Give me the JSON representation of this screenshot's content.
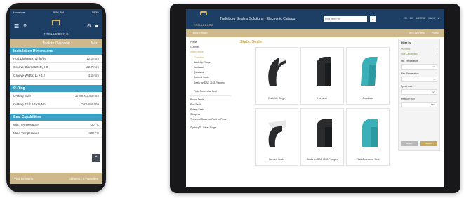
{
  "phone": {
    "status": {
      "left": "Vodafone",
      "time": "5:58 PM",
      "right": "100%"
    },
    "logo_text": "TRELLEBORG",
    "back_label": "Back to Overview",
    "next_label": "Next",
    "sections": [
      {
        "title": "Installation Dimensions",
        "rows": [
          {
            "label": "Rod Diameter: d₀ f8/h9",
            "value": "12.0 mm"
          },
          {
            "label": "Groove Diameter: D₁ H8",
            "value": "22.7 mm"
          },
          {
            "label": "Groove Width: L₁ +0.2",
            "value": "4.2 mm"
          }
        ]
      },
      {
        "title": "O-Ring",
        "rows": [
          {
            "label": "O-Ring Size",
            "value": "17.86 x 3.53 mm"
          },
          {
            "label": "O-Ring TSS Article No.",
            "value": "ORAR00209"
          }
        ]
      },
      {
        "title": "Seal Capabilities",
        "rows": [
          {
            "label": "Min. Temperature",
            "value": "-30 °C"
          },
          {
            "label": "Max. Temperature",
            "value": "100 °C"
          }
        ]
      }
    ],
    "footer": {
      "left": "Visit Scenario",
      "right": "0 Items | 0 Favorites"
    }
  },
  "tablet": {
    "logo_text": "TRELLEBORG",
    "title": "Trelleborg Sealing Solutions - Electronic Catalog",
    "search_placeholder": "Find items no",
    "header_right": [
      "EN",
      "DE",
      "METRIC",
      "INCH"
    ],
    "subbar": {
      "left": "Home » Static",
      "right_1": "Item overview",
      "right_2": "Profile"
    },
    "sidebar": [
      {
        "label": "Home",
        "cls": ""
      },
      {
        "label": "O-Rings",
        "cls": ""
      },
      {
        "label": "Static Seals",
        "cls": "active"
      },
      {
        "label": "Overview",
        "cls": "sub active"
      },
      {
        "label": "Back-Up Rings",
        "cls": "sub"
      },
      {
        "label": "Kantseal",
        "cls": "sub"
      },
      {
        "label": "Quadseal",
        "cls": "sub"
      },
      {
        "label": "Bonded Seals",
        "cls": "sub"
      },
      {
        "label": "Seals for SAE J518 Flanges",
        "cls": "sub ml"
      },
      {
        "label": "Fluid Connector Seal",
        "cls": "sub"
      },
      {
        "label": "Piston Seals",
        "cls": "",
        "sep": true
      },
      {
        "label": "Rod Seals",
        "cls": ""
      },
      {
        "label": "Rotary Seals",
        "cls": ""
      },
      {
        "label": "Scrapers",
        "cls": ""
      },
      {
        "label": "Technical Seals for Fluid or Power",
        "cls": "ml"
      },
      {
        "label": "Slydring® - Wear Rings",
        "cls": ""
      }
    ],
    "main_title": "Static Seals",
    "cards": [
      {
        "label": "Back-Up Rings",
        "shape": "arc-dark"
      },
      {
        "label": "Kantseal",
        "shape": "block-dark"
      },
      {
        "label": "Quadseal",
        "shape": "block-teal"
      },
      {
        "label": "Bonded Seals",
        "shape": "bonded"
      },
      {
        "label": "Seals for SAE J518 Flanges",
        "shape": "flange-dark"
      },
      {
        "label": "Fluid Connector Seal",
        "shape": "flange-teal"
      }
    ],
    "filter": {
      "title": "Filter by",
      "links": [
        "Overview",
        "Seal Capabilities"
      ],
      "fields": [
        {
          "label": "Min. Temperature",
          "unit": "°C"
        },
        {
          "label": "Max. Temperature",
          "unit": "°C"
        },
        {
          "label": "Speed max.",
          "unit": "m/s"
        },
        {
          "label": "Pressure max.",
          "unit": "MPa"
        }
      ],
      "reset_label": "Reset",
      "search_label": "Search"
    }
  },
  "colors": {
    "navy": "#1d3f66",
    "gold": "#cdb98b",
    "teal": "#3aa0c5",
    "seal_dark": "#2a2b2d",
    "seal_teal": "#3bb0b8"
  }
}
